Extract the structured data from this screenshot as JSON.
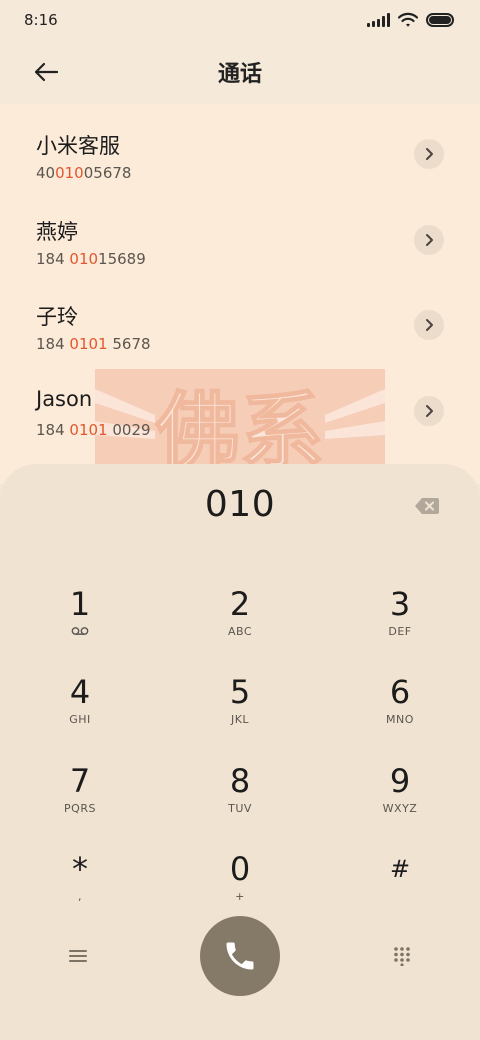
{
  "status_bar": {
    "time": "8:16"
  },
  "header": {
    "title": "通话"
  },
  "contacts": [
    {
      "name": "小米客服",
      "number_pre": "40",
      "number_hl": "010",
      "number_post": "05678"
    },
    {
      "name": "燕婷",
      "number_pre": "184 ",
      "number_hl": "010",
      "number_post": "15689"
    },
    {
      "name": "子玲",
      "number_pre": "184 ",
      "number_hl": "0101",
      "number_post": " 5678"
    },
    {
      "name": "Jason",
      "number_pre": "184 ",
      "number_hl": "0101",
      "number_post": " 0029"
    }
  ],
  "watermark": {
    "text": "佛系"
  },
  "dialpad": {
    "dialed": "010",
    "keys": [
      {
        "digit": "1",
        "letters": ""
      },
      {
        "digit": "2",
        "letters": "ABC"
      },
      {
        "digit": "3",
        "letters": "DEF"
      },
      {
        "digit": "4",
        "letters": "GHI"
      },
      {
        "digit": "5",
        "letters": "JKL"
      },
      {
        "digit": "6",
        "letters": "MNO"
      },
      {
        "digit": "7",
        "letters": "PQRS"
      },
      {
        "digit": "8",
        "letters": "TUV"
      },
      {
        "digit": "9",
        "letters": "WXYZ"
      },
      {
        "digit": "*",
        "letters": ","
      },
      {
        "digit": "0",
        "letters": "+"
      },
      {
        "digit": "#",
        "letters": ""
      }
    ]
  },
  "colors": {
    "accent_highlight": "#e2572f",
    "call_button": "#857968",
    "background": "#f3e6d4"
  }
}
